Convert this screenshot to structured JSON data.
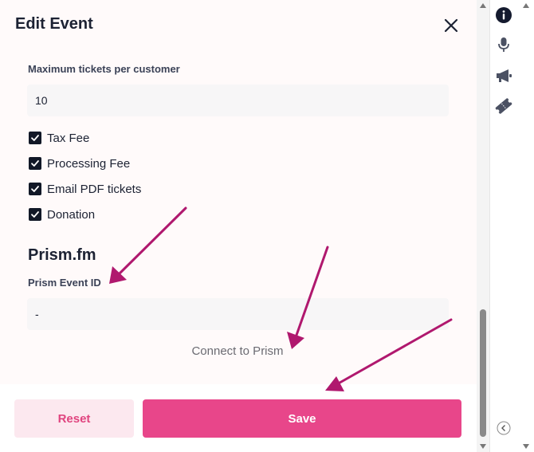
{
  "header": {
    "title": "Edit Event"
  },
  "form": {
    "max_tickets": {
      "label": "Maximum tickets per customer",
      "value": "10"
    },
    "checkboxes": [
      {
        "label": "Tax Fee",
        "checked": true
      },
      {
        "label": "Processing Fee",
        "checked": true
      },
      {
        "label": "Email PDF tickets",
        "checked": true
      },
      {
        "label": "Donation",
        "checked": true
      }
    ]
  },
  "prism": {
    "section_title": "Prism.fm",
    "event_id_label": "Prism Event ID",
    "event_id_value": "-",
    "connect_label": "Connect to Prism"
  },
  "footer": {
    "reset_label": "Reset",
    "save_label": "Save"
  },
  "colors": {
    "accent": "#e8468a",
    "accent_soft": "#fce8ef",
    "annotation_arrow": "#b0186e",
    "text_dark": "#1c2233"
  },
  "side_rail": {
    "icons": [
      "info-icon",
      "microphone-icon",
      "megaphone-icon",
      "ticket-icon",
      "collapse-chevron-icon"
    ]
  }
}
